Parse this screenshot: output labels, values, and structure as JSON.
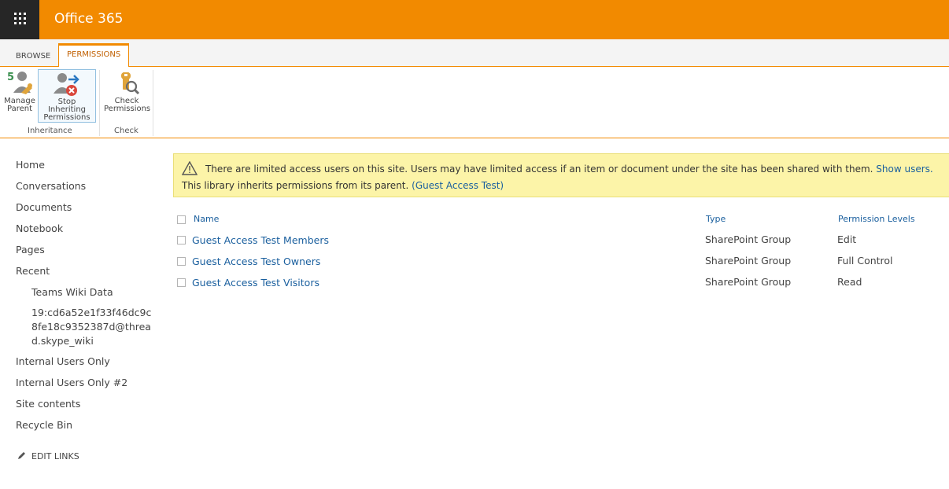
{
  "suite": {
    "title": "Office 365"
  },
  "tabs": [
    {
      "label": "BROWSE"
    },
    {
      "label": "PERMISSIONS"
    }
  ],
  "ribbon": {
    "manage_parent": {
      "line1": "Manage",
      "line2": "Parent"
    },
    "stop_inheriting": {
      "line1": "Stop Inheriting",
      "line2": "Permissions"
    },
    "check_permissions": {
      "line1": "Check",
      "line2": "Permissions"
    },
    "group_inheritance": "Inheritance",
    "group_check": "Check"
  },
  "nav": {
    "items": [
      "Home",
      "Conversations",
      "Documents",
      "Notebook",
      "Pages",
      "Recent"
    ],
    "recent_items": [
      "Teams Wiki Data",
      "19:cd6a52e1f33f46dc9c",
      "8fe18c9352387d@threa",
      "d.skype_wiki"
    ],
    "more_items": [
      "Internal Users Only",
      "Internal Users Only #2",
      "Site contents",
      "Recycle Bin"
    ],
    "edit_links": "EDIT LINKS"
  },
  "notice": {
    "line1": "There are limited access users on this site. Users may have limited access if an item or document under the site has been shared with them.",
    "line1_link": "Show users.",
    "line2": "This library inherits permissions from its parent.",
    "line2_link": "(Guest Access Test)"
  },
  "table": {
    "headers": {
      "name": "Name",
      "type": "Type",
      "levels": "Permission Levels"
    },
    "rows": [
      {
        "name": "Guest Access Test Members",
        "type": "SharePoint Group",
        "level": "Edit"
      },
      {
        "name": "Guest Access Test Owners",
        "type": "SharePoint Group",
        "level": "Full Control"
      },
      {
        "name": "Guest Access Test Visitors",
        "type": "SharePoint Group",
        "level": "Read"
      }
    ]
  },
  "colors": {
    "suite_bar": "#f28a00",
    "waffle": "#262626",
    "link": "#1a5f9e",
    "notice_bg": "#fcf4a8"
  }
}
